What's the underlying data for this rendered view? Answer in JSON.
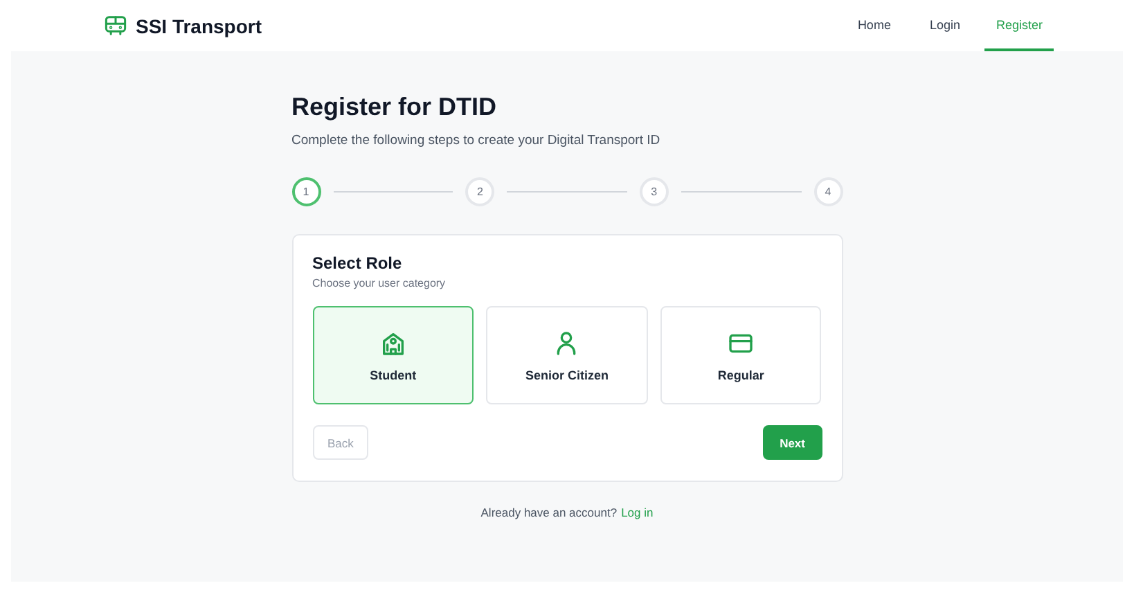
{
  "brand": {
    "name": "SSI Transport"
  },
  "nav": [
    {
      "label": "Home",
      "selected": false
    },
    {
      "label": "Login",
      "selected": false
    },
    {
      "label": "Register",
      "selected": true
    }
  ],
  "title": "Register for DTID",
  "subtitle": "Complete the following steps to create your Digital Transport ID",
  "steps": [
    {
      "label": "1",
      "selected": true
    },
    {
      "label": "2",
      "selected": false
    },
    {
      "label": "3",
      "selected": false
    },
    {
      "label": "4",
      "selected": false
    }
  ],
  "card": {
    "title": "Select Role",
    "subtitle": "Choose your user category",
    "roles": [
      {
        "label": "Student",
        "kind": "school",
        "selected": true
      },
      {
        "label": "Senior Citizen",
        "kind": "person",
        "selected": false
      },
      {
        "label": "Regular",
        "kind": "card",
        "selected": false
      }
    ],
    "back": {
      "label": "Back",
      "disabled": true
    },
    "next": {
      "label": "Next",
      "disabled": false
    }
  },
  "footer": {
    "text": "Already have an account?",
    "link": "Log in"
  }
}
